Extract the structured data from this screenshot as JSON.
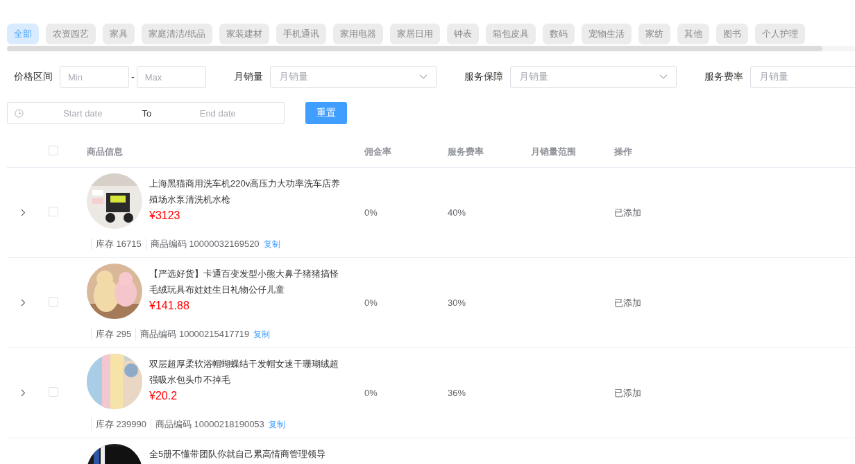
{
  "categories": [
    {
      "label": "全部",
      "selected": true
    },
    {
      "label": "农资园艺",
      "selected": false
    },
    {
      "label": "家具",
      "selected": false
    },
    {
      "label": "家庭清洁/纸品",
      "selected": false
    },
    {
      "label": "家装建材",
      "selected": false
    },
    {
      "label": "手机通讯",
      "selected": false
    },
    {
      "label": "家用电器",
      "selected": false
    },
    {
      "label": "家居日用",
      "selected": false
    },
    {
      "label": "钟表",
      "selected": false
    },
    {
      "label": "箱包皮具",
      "selected": false
    },
    {
      "label": "数码",
      "selected": false
    },
    {
      "label": "宠物生活",
      "selected": false
    },
    {
      "label": "家纺",
      "selected": false
    },
    {
      "label": "其他",
      "selected": false
    },
    {
      "label": "图书",
      "selected": false
    },
    {
      "label": "个人护理",
      "selected": false
    }
  ],
  "filters": {
    "price_label": "价格区间",
    "min_placeholder": "Min",
    "separator": "-",
    "max_placeholder": "Max",
    "selects": [
      {
        "label": "月销量",
        "placeholder": "月销量"
      },
      {
        "label": "服务保障",
        "placeholder": "月销量"
      },
      {
        "label": "服务费率",
        "placeholder": "月销量"
      }
    ],
    "date_range": {
      "start_placeholder": "Start date",
      "separator": "To",
      "end_placeholder": "End date"
    },
    "reset_button": "重置"
  },
  "table": {
    "select_all": {
      "checked": false
    },
    "columns": [
      "商品信息",
      "佣金率",
      "服务费率",
      "月销量范围",
      "操作"
    ],
    "rows": [
      {
        "expanded": false,
        "checked": false,
        "title": "上海黑猫商用洗车机220v高压力大功率洗车店养殖场水泵清洗机水枪",
        "price": "¥3123",
        "stock": "库存 16715",
        "code": "商品编码 10000032169520",
        "copy": "复制",
        "commission": "0%",
        "service_rate": "40%",
        "status": "已添加"
      },
      {
        "expanded": false,
        "checked": false,
        "title": "【严选好货】卡通百变发型小熊大鼻子猪猪搞怪毛绒玩具布娃娃生日礼物公仔儿童",
        "price": "¥141.88",
        "stock": "库存 295",
        "code": "商品编码 10000215417719",
        "copy": "复制",
        "commission": "0%",
        "service_rate": "30%",
        "status": "已添加"
      },
      {
        "expanded": false,
        "checked": false,
        "title": "双层超厚柔软浴帽蝴蝶结干发帽女速干珊瑚绒超强吸水包头巾不掉毛",
        "price": "¥20.2",
        "stock": "库存 239990",
        "code": "商品编码 10000218190053",
        "copy": "复制",
        "commission": "0%",
        "service_rate": "36%",
        "status": "已添加"
      },
      {
        "title": "全5册不懂带团队你就自己累高情商管理领导"
      }
    ]
  }
}
